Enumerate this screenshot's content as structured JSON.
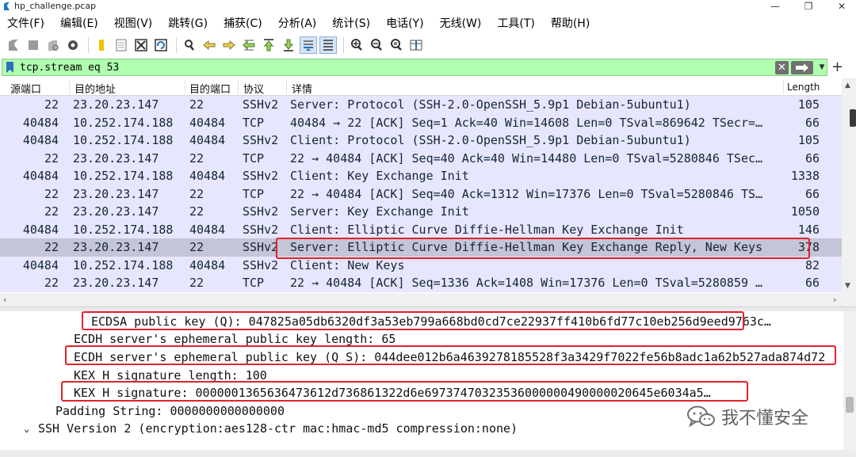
{
  "window": {
    "title": "hp_challenge.pcap",
    "minimize": "—",
    "restore": "❐",
    "close": "✕"
  },
  "menu": [
    "文件(F)",
    "编辑(E)",
    "视图(V)",
    "跳转(G)",
    "捕获(C)",
    "分析(A)",
    "统计(S)",
    "电话(Y)",
    "无线(W)",
    "工具(T)",
    "帮助(H)"
  ],
  "filter": {
    "value": "tcp.stream eq 53"
  },
  "columns": {
    "src_port": "源端口",
    "dst_addr": "目的地址",
    "dst_port": "目的端口",
    "protocol": "协议",
    "info": "详情",
    "length": "Length"
  },
  "packets": [
    {
      "src_port": "22",
      "dst": "23.20.23.147",
      "dst_port": "22",
      "proto": "SSHv2",
      "info": "Server: Protocol (SSH-2.0-OpenSSH_5.9p1 Debian-5ubuntu1)",
      "len": "105"
    },
    {
      "src_port": "40484",
      "dst": "10.252.174.188",
      "dst_port": "40484",
      "proto": "TCP",
      "info": "40484 → 22 [ACK] Seq=1 Ack=40 Win=14608 Len=0 TSval=869642 TSecr=…",
      "len": "66"
    },
    {
      "src_port": "40484",
      "dst": "10.252.174.188",
      "dst_port": "40484",
      "proto": "SSHv2",
      "info": "Client: Protocol (SSH-2.0-OpenSSH_5.9p1 Debian-5ubuntu1)",
      "len": "105"
    },
    {
      "src_port": "22",
      "dst": "23.20.23.147",
      "dst_port": "22",
      "proto": "TCP",
      "info": "22 → 40484 [ACK] Seq=40 Ack=40 Win=14480 Len=0 TSval=5280846 TSec…",
      "len": "66"
    },
    {
      "src_port": "40484",
      "dst": "10.252.174.188",
      "dst_port": "40484",
      "proto": "SSHv2",
      "info": "Client: Key Exchange Init",
      "len": "1338"
    },
    {
      "src_port": "22",
      "dst": "23.20.23.147",
      "dst_port": "22",
      "proto": "TCP",
      "info": "22 → 40484 [ACK] Seq=40 Ack=1312 Win=17376 Len=0 TSval=5280846 TS…",
      "len": "66"
    },
    {
      "src_port": "22",
      "dst": "23.20.23.147",
      "dst_port": "22",
      "proto": "SSHv2",
      "info": "Server: Key Exchange Init",
      "len": "1050"
    },
    {
      "src_port": "40484",
      "dst": "10.252.174.188",
      "dst_port": "40484",
      "proto": "SSHv2",
      "info": "Client: Elliptic Curve Diffie-Hellman Key Exchange Init",
      "len": "146"
    },
    {
      "src_port": "22",
      "dst": "23.20.23.147",
      "dst_port": "22",
      "proto": "SSHv2",
      "info": "Server: Elliptic Curve Diffie-Hellman Key Exchange Reply, New Keys",
      "len": "378"
    },
    {
      "src_port": "40484",
      "dst": "10.252.174.188",
      "dst_port": "40484",
      "proto": "SSHv2",
      "info": "Client: New Keys",
      "len": "82"
    },
    {
      "src_port": "22",
      "dst": "23.20.23.147",
      "dst_port": "22",
      "proto": "TCP",
      "info": "22 → 40484 [ACK] Seq=1336 Ack=1408 Win=17376 Len=0 TSval=5280859 …",
      "len": "66"
    }
  ],
  "selected_packet": 8,
  "details": [
    {
      "text": "ECDSA public key (Q): 047825a05db6320df3a53eb799a668bd0cd7ce22937ff410b6fd77c10eb256d9eed9763c…"
    },
    {
      "text": "ECDH server's ephemeral public key length: 65"
    },
    {
      "text": "ECDH server's ephemeral public key (Q_S): 044dee012b6a4639278185528f3a3429f7022fe56b8adc1a62b527ada874d72"
    },
    {
      "text": "KEX H signature length: 100"
    },
    {
      "text": "KEX H signature: 0000001365636473612d736861322d6e69737470323536000000490000020645e6034a5…"
    },
    {
      "text": "Padding String: 0000000000000000"
    },
    {
      "text": "SSH Version 2 (encryption:aes128-ctr mac:hmac-md5 compression:none)"
    }
  ],
  "watermark": {
    "text": "我不懂安全"
  },
  "colors": {
    "row_bg": "#e7e6ff",
    "selected_bg": "#c5c5d8",
    "filter_bg": "#afffaf",
    "highlight": "#e5202a"
  }
}
